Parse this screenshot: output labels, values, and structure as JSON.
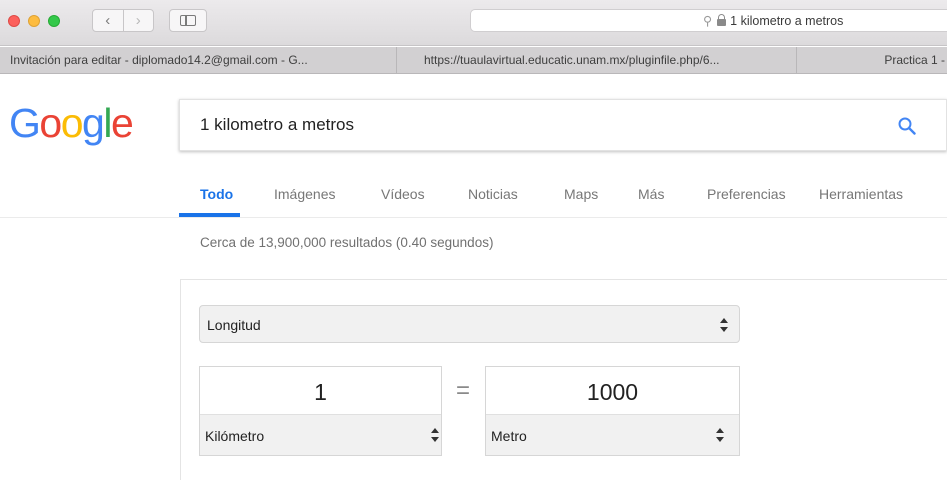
{
  "browser": {
    "address": "1 kilometro a metros",
    "tabs": [
      {
        "label": "Invitación para editar - diplomado14.2@gmail.com - G..."
      },
      {
        "label": "https://tuaulavirtual.educatic.unam.mx/pluginfile.php/6..."
      },
      {
        "label": "Practica 1 -"
      }
    ],
    "back_glyph": "‹",
    "forward_glyph": "›",
    "search_glyph": "⚲"
  },
  "google": {
    "logo": {
      "G": "G",
      "o1": "o",
      "o2": "o",
      "g": "g",
      "l": "l",
      "e": "e"
    },
    "query": "1 kilometro a metros",
    "nav_tabs": [
      "Todo",
      "Imágenes",
      "Vídeos",
      "Noticias",
      "Maps",
      "Más",
      "Preferencias",
      "Herramientas"
    ],
    "active_tab": "Todo",
    "result_stats": "Cerca de 13,900,000 resultados (0.40 segundos)",
    "colors": {
      "blue": "#4285f4",
      "red": "#ea4335",
      "yellow": "#fbbc05",
      "green": "#34a853",
      "accent": "#1a73e8"
    }
  },
  "converter": {
    "category": "Longitud",
    "equals": "=",
    "from": {
      "value": "1",
      "unit": "Kilómetro"
    },
    "to": {
      "value": "1000",
      "unit": "Metro"
    }
  }
}
